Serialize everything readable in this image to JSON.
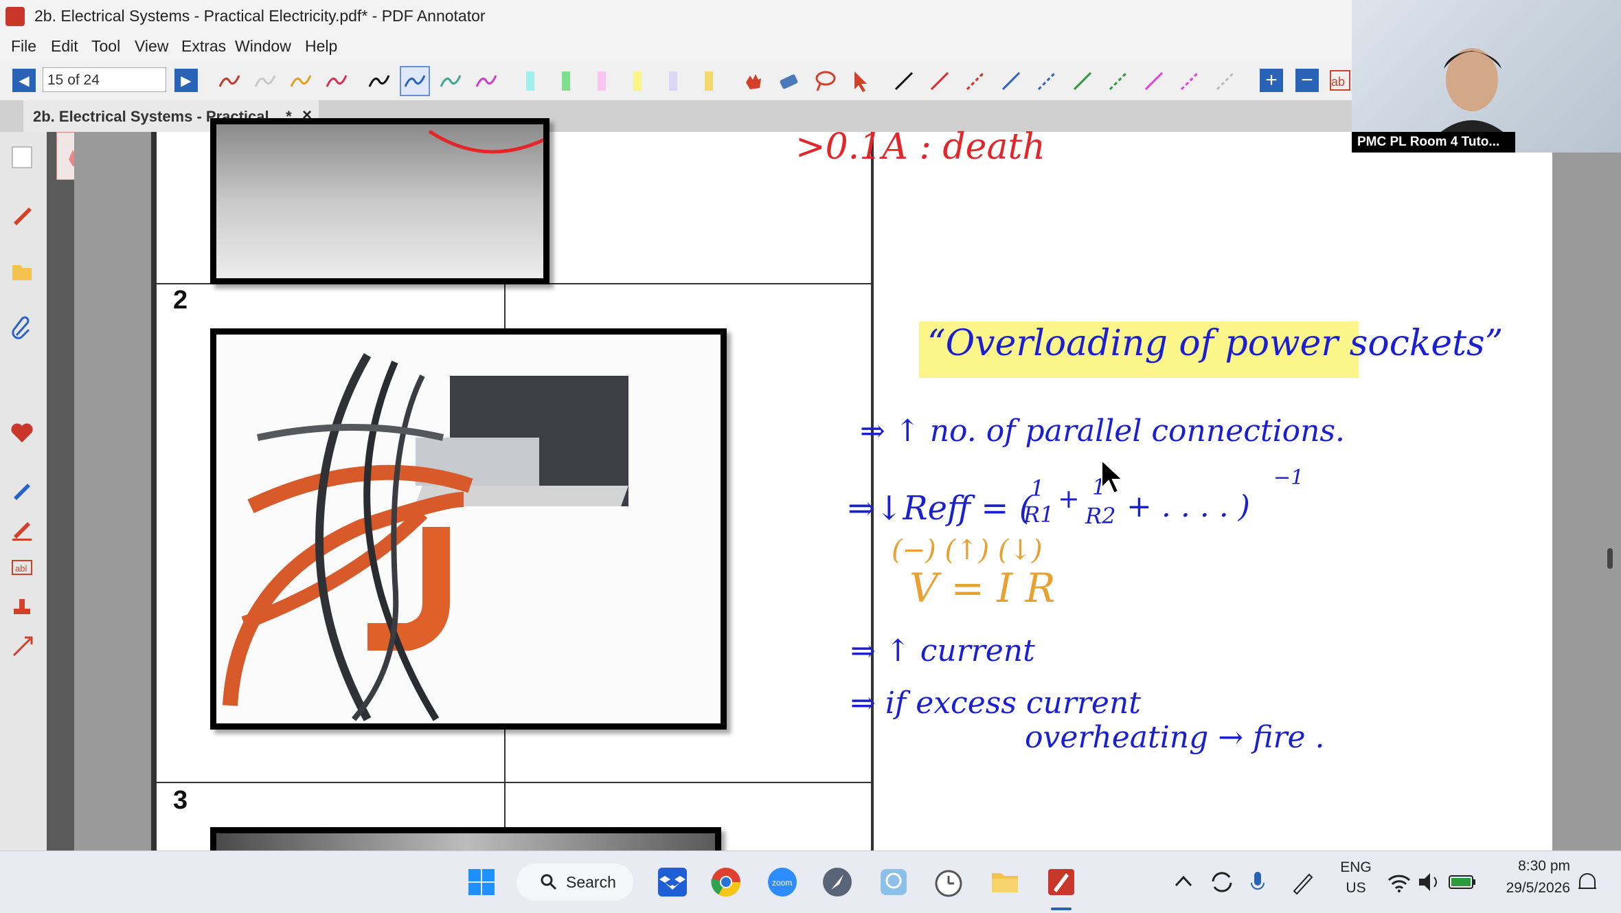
{
  "window": {
    "title": "2b. Electrical Systems - Practical Electricity.pdf* - PDF Annotator"
  },
  "menu": [
    "File",
    "Edit",
    "Tool",
    "View",
    "Extras",
    "Window",
    "Help"
  ],
  "toolbar": {
    "page_indicator": "15 of 24",
    "pen_colors": [
      "#c0392b",
      "#c8c8c8",
      "#e0a020",
      "#d6304a",
      "#111111",
      "#2a62c8",
      "#3aaa8a",
      "#d23cc8"
    ],
    "highlighter_colors": [
      "#9ff0ec",
      "#7ee08e",
      "#f7c6f0",
      "#fbf58a",
      "#dcd6f5",
      "#f5d86a"
    ],
    "line_colors": [
      "#111111",
      "#e2262a",
      "#e2262a",
      "#2a62c8",
      "#2a62c8",
      "#2a9a3a",
      "#2a9a3a",
      "#e040e0",
      "#e040e0",
      "#bbbbbb"
    ],
    "text_tool_label": "ab"
  },
  "tab": {
    "label": "2b. Electrical Systems - Practical ...*",
    "close": "×"
  },
  "document": {
    "rows": [
      {
        "number": "2"
      },
      {
        "number": "3"
      }
    ],
    "annotations": {
      "row1_note": ">0.1A  : death",
      "title": "“Overloading of power sockets”",
      "line1": "⇒ ↑ no. of parallel connections.",
      "line2_left": "⇒↓Reff = (",
      "frac1_num": "1",
      "frac1_den": "R1",
      "plus": "+",
      "frac2_num": "1",
      "frac2_den": "R2",
      "line2_right": "+ . . . . )",
      "exponent": "−1",
      "signs": "(−)  (↑)  (↓)",
      "ohms_law": "V = I R",
      "line3": "⇒ ↑  current",
      "line4": "⇒ if excess current",
      "line5": "overheating → fire ."
    }
  },
  "webcam": {
    "name": "PMC PL Room 4 Tuto..."
  },
  "taskbar": {
    "search_label": "Search",
    "language": "ENG",
    "region": "US",
    "time": "8:30 pm",
    "date": "29/5/2026"
  },
  "colors": {
    "ink_blue": "#1a1fd0",
    "ink_red": "#e2262a",
    "ink_orange": "#e9a030",
    "highlight_yellow": "#fbf58a",
    "accent_blue": "#2a62b8"
  }
}
